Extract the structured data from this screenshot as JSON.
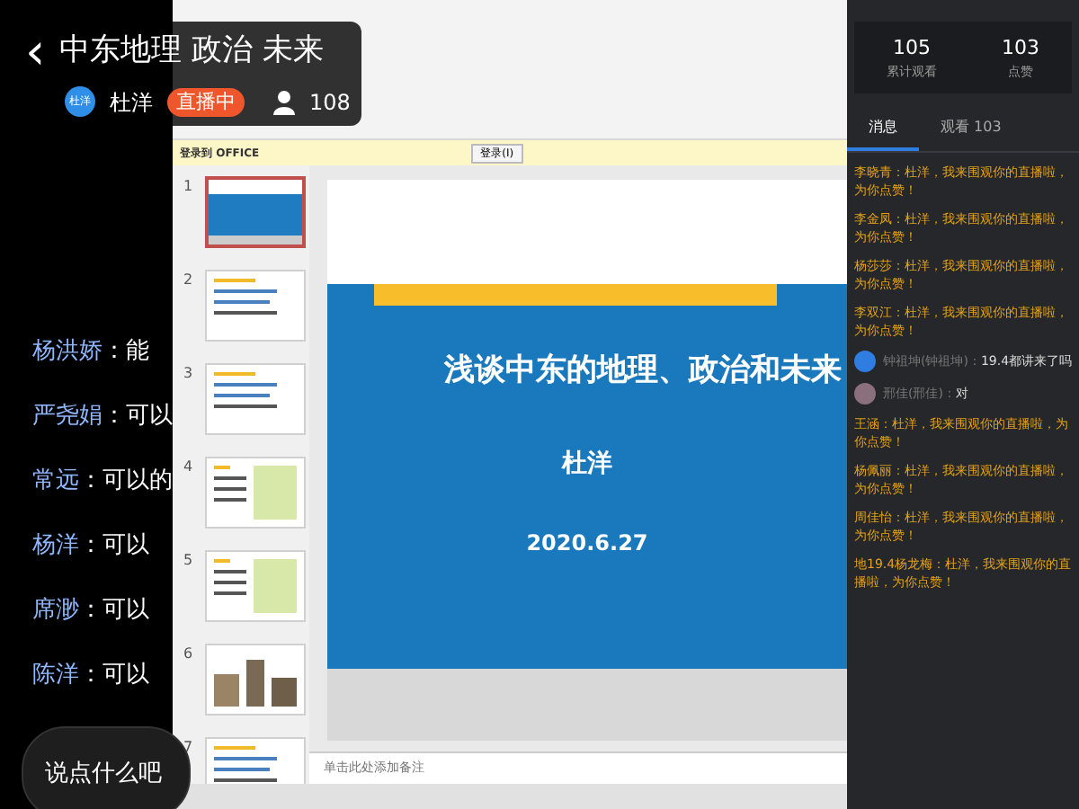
{
  "header": {
    "back": "‹",
    "title": "中东地理 政治 未来",
    "avatar": "杜洋",
    "host": "杜洋",
    "live_badge": "直播中",
    "viewers": "108"
  },
  "separator": "：",
  "comments": [
    {
      "user": "杨洪娇",
      "text": "能"
    },
    {
      "user": "严尧娟",
      "text": "可以"
    },
    {
      "user": "常远",
      "text": "可以的"
    },
    {
      "user": "杨洋",
      "text": "可以"
    },
    {
      "user": "席渺",
      "text": "可以"
    },
    {
      "user": "陈洋",
      "text": "可以"
    }
  ],
  "comment_input": {
    "placeholder": "说点什么吧"
  },
  "ppt": {
    "notice_label": "登录到 OFFICE",
    "notice_button": "登录(I)",
    "slides": [
      {
        "number": "1",
        "kind": "title",
        "selected": true
      },
      {
        "number": "2",
        "kind": "text",
        "selected": false
      },
      {
        "number": "3",
        "kind": "text",
        "selected": false
      },
      {
        "number": "4",
        "kind": "map",
        "selected": false
      },
      {
        "number": "5",
        "kind": "map",
        "selected": false
      },
      {
        "number": "6",
        "kind": "photos",
        "selected": false
      },
      {
        "number": "7",
        "kind": "text",
        "selected": false
      }
    ],
    "slide": {
      "title": "浅谈中东的地理、政治和未来",
      "author": "杜洋",
      "date": "2020.6.27"
    },
    "notes_placeholder": "单击此处添加备注"
  },
  "stats": [
    {
      "value": "105",
      "label": "累计观看"
    },
    {
      "value": "103",
      "label": "点赞"
    }
  ],
  "chat_tabs": [
    {
      "label": "消息",
      "selected": true
    },
    {
      "label": "观看 103",
      "selected": false
    }
  ],
  "chat": [
    {
      "kind": "system",
      "user": "李晓青",
      "text": "杜洋，我来围观你的直播啦，为你点赞！"
    },
    {
      "kind": "system",
      "user": "李金凤",
      "text": "杜洋，我来围观你的直播啦，为你点赞！"
    },
    {
      "kind": "system",
      "user": "杨莎莎",
      "text": "杜洋，我来围观你的直播啦，为你点赞！"
    },
    {
      "kind": "system",
      "user": "李双江",
      "text": "杜洋，我来围观你的直播啦，为你点赞！"
    },
    {
      "kind": "user",
      "user": "钟祖坤(钟祖坤)",
      "text": "19.4都讲来了吗",
      "color": "#2f7de1"
    },
    {
      "kind": "user",
      "user": "邢佳(邢佳)",
      "text": "对",
      "color": "#8a6f7c"
    },
    {
      "kind": "system",
      "user": "王涵",
      "text": "杜洋，我来围观你的直播啦，为你点赞！"
    },
    {
      "kind": "system",
      "user": "杨佩丽",
      "text": "杜洋，我来围观你的直播啦，为你点赞！"
    },
    {
      "kind": "system",
      "user": "周佳怡",
      "text": "杜洋，我来围观你的直播啦，为你点赞！"
    },
    {
      "kind": "system",
      "user": "地19.4杨龙梅",
      "text": "杜洋，我来围观你的直播啦，为你点赞！"
    }
  ]
}
